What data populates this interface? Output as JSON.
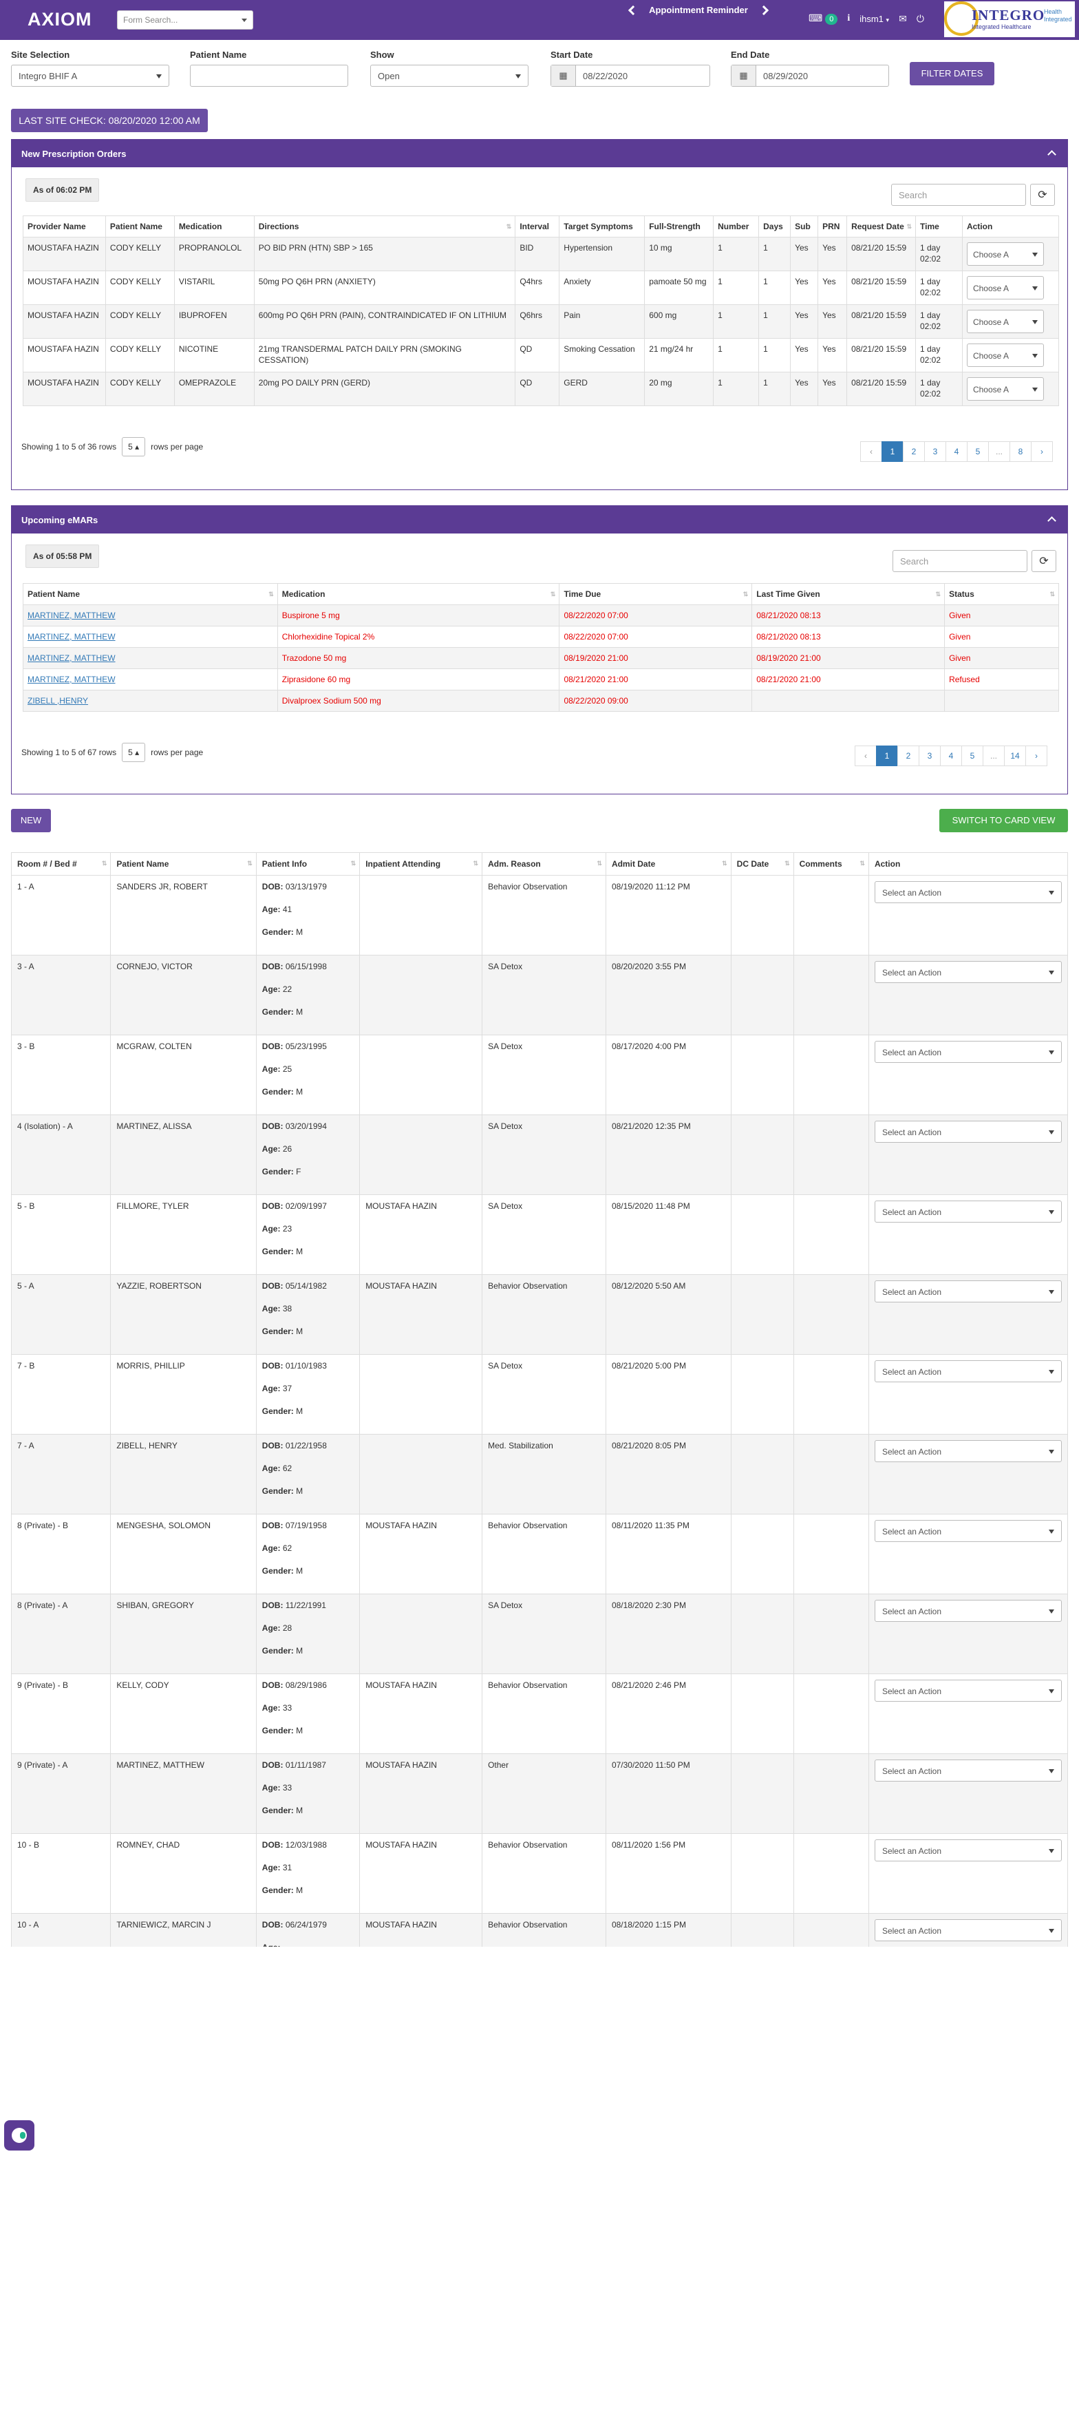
{
  "app": {
    "brand": "AXIOM"
  },
  "topbar": {
    "form_search_placeholder": "Form Search...",
    "appointment_reminder": "Appointment Reminder",
    "message_count": "0",
    "user_menu": "ihsm1",
    "logo_text": "INTEGRO",
    "logo_sub": "Integrated Healthcare",
    "logo_side": "Health Integrated"
  },
  "filters": {
    "site_label": "Site Selection",
    "site_value": "Integro BHIF A",
    "patient_label": "Patient Name",
    "patient_value": "",
    "show_label": "Show",
    "show_value": "Open",
    "start_label": "Start Date",
    "start_value": "08/22/2020",
    "end_label": "End Date",
    "end_value": "08/29/2020",
    "filter_button": "FILTER DATES",
    "last_site_check": "LAST SITE CHECK: 08/20/2020 12:00 AM"
  },
  "prescriptions": {
    "title": "New Prescription Orders",
    "as_of": "As of 06:02 PM",
    "search_placeholder": "Search",
    "columns": [
      "Provider Name",
      "Patient Name",
      "Medication",
      "Directions",
      "Interval",
      "Target Symptoms",
      "Full-Strength",
      "Number",
      "Days",
      "Sub",
      "PRN",
      "Request Date",
      "Time",
      "Action"
    ],
    "rows": [
      {
        "provider": "MOUSTAFA HAZIN",
        "patient": "CODY KELLY",
        "medication": "PROPRANOLOL",
        "directions": "PO BID PRN (HTN) SBP > 165",
        "interval": "BID",
        "symptoms": "Hypertension",
        "strength": "10 mg",
        "number": "1",
        "days": "1",
        "sub": "Yes",
        "prn": "Yes",
        "request_date": "08/21/20 15:59",
        "time": "1 day 02:02",
        "action": "Choose A"
      },
      {
        "provider": "MOUSTAFA HAZIN",
        "patient": "CODY KELLY",
        "medication": "VISTARIL",
        "directions": "50mg PO Q6H PRN (ANXIETY)",
        "interval": "Q4hrs",
        "symptoms": "Anxiety",
        "strength": "pamoate 50 mg",
        "number": "1",
        "days": "1",
        "sub": "Yes",
        "prn": "Yes",
        "request_date": "08/21/20 15:59",
        "time": "1 day 02:02",
        "action": "Choose A"
      },
      {
        "provider": "MOUSTAFA HAZIN",
        "patient": "CODY KELLY",
        "medication": "IBUPROFEN",
        "directions": "600mg PO Q6H PRN (PAIN), CONTRAINDICATED IF ON LITHIUM",
        "interval": "Q6hrs",
        "symptoms": "Pain",
        "strength": "600 mg",
        "number": "1",
        "days": "1",
        "sub": "Yes",
        "prn": "Yes",
        "request_date": "08/21/20 15:59",
        "time": "1 day 02:02",
        "action": "Choose A"
      },
      {
        "provider": "MOUSTAFA HAZIN",
        "patient": "CODY KELLY",
        "medication": "NICOTINE",
        "directions": "21mg TRANSDERMAL PATCH DAILY PRN (SMOKING CESSATION)",
        "interval": "QD",
        "symptoms": "Smoking Cessation",
        "strength": "21 mg/24 hr",
        "number": "1",
        "days": "1",
        "sub": "Yes",
        "prn": "Yes",
        "request_date": "08/21/20 15:59",
        "time": "1 day 02:02",
        "action": "Choose A"
      },
      {
        "provider": "MOUSTAFA HAZIN",
        "patient": "CODY KELLY",
        "medication": "OMEPRAZOLE",
        "directions": "20mg PO DAILY PRN (GERD)",
        "interval": "QD",
        "symptoms": "GERD",
        "strength": "20 mg",
        "number": "1",
        "days": "1",
        "sub": "Yes",
        "prn": "Yes",
        "request_date": "08/21/20 15:59",
        "time": "1 day 02:02",
        "action": "Choose A"
      }
    ],
    "showing": "Showing 1 to 5 of 36 rows",
    "page_size": "5",
    "rows_per_page": "rows per page",
    "pages": [
      "‹",
      "1",
      "2",
      "3",
      "4",
      "5",
      "...",
      "8",
      "›"
    ]
  },
  "emars": {
    "title": "Upcoming eMARs",
    "as_of": "As of 05:58 PM",
    "search_placeholder": "Search",
    "columns": [
      "Patient Name",
      "Medication",
      "Time Due",
      "Last Time Given",
      "Status"
    ],
    "rows": [
      {
        "patient": "MARTINEZ, MATTHEW",
        "medication": "Buspirone 5 mg",
        "due": "08/22/2020 07:00",
        "last": "08/21/2020 08:13",
        "status": "Given"
      },
      {
        "patient": "MARTINEZ, MATTHEW",
        "medication": "Chlorhexidine Topical 2%",
        "due": "08/22/2020 07:00",
        "last": "08/21/2020 08:13",
        "status": "Given"
      },
      {
        "patient": "MARTINEZ, MATTHEW",
        "medication": "Trazodone 50 mg",
        "due": "08/19/2020 21:00",
        "last": "08/19/2020 21:00",
        "status": "Given"
      },
      {
        "patient": "MARTINEZ, MATTHEW",
        "medication": "Ziprasidone 60 mg",
        "due": "08/21/2020 21:00",
        "last": "08/21/2020 21:00",
        "status": "Refused"
      },
      {
        "patient": "ZIBELL ,HENRY",
        "medication": "Divalproex Sodium 500 mg",
        "due": "08/22/2020 09:00",
        "last": "",
        "status": ""
      }
    ],
    "showing": "Showing 1 to 5 of 67 rows",
    "page_size": "5",
    "rows_per_page": "rows per page",
    "pages": [
      "‹",
      "1",
      "2",
      "3",
      "4",
      "5",
      "...",
      "14",
      "›"
    ]
  },
  "census": {
    "new_button": "NEW",
    "card_view_button": "SWITCH TO CARD VIEW",
    "columns": [
      "Room # / Bed #",
      "Patient Name",
      "Patient Info",
      "Inpatient Attending",
      "Adm. Reason",
      "Admit Date",
      "DC Date",
      "Comments",
      "Action"
    ],
    "dob_label": "DOB:",
    "age_label": "Age:",
    "gender_label": "Gender:",
    "action_placeholder": "Select an Action",
    "rows": [
      {
        "room": "1 - A",
        "name": "SANDERS JR, ROBERT",
        "dob": "03/13/1979",
        "age": "41",
        "gender": "M",
        "attending": "",
        "reason": "Behavior Observation",
        "admit": "08/19/2020 11:12 PM"
      },
      {
        "room": "3 - A",
        "name": "CORNEJO, VICTOR",
        "dob": "06/15/1998",
        "age": "22",
        "gender": "M",
        "attending": "",
        "reason": "SA Detox",
        "admit": "08/20/2020 3:55 PM"
      },
      {
        "room": "3 - B",
        "name": "MCGRAW, COLTEN",
        "dob": "05/23/1995",
        "age": "25",
        "gender": "M",
        "attending": "",
        "reason": "SA Detox",
        "admit": "08/17/2020 4:00 PM"
      },
      {
        "room": "4 (Isolation) - A",
        "name": "MARTINEZ, ALISSA",
        "dob": "03/20/1994",
        "age": "26",
        "gender": "F",
        "attending": "",
        "reason": "SA Detox",
        "admit": "08/21/2020 12:35 PM"
      },
      {
        "room": "5 - B",
        "name": "FILLMORE, TYLER",
        "dob": "02/09/1997",
        "age": "23",
        "gender": "M",
        "attending": "MOUSTAFA HAZIN",
        "reason": "SA Detox",
        "admit": "08/15/2020 11:48 PM"
      },
      {
        "room": "5 - A",
        "name": "YAZZIE, ROBERTSON",
        "dob": "05/14/1982",
        "age": "38",
        "gender": "M",
        "attending": "MOUSTAFA HAZIN",
        "reason": "Behavior Observation",
        "admit": "08/12/2020 5:50 AM"
      },
      {
        "room": "7 - B",
        "name": "MORRIS, PHILLIP",
        "dob": "01/10/1983",
        "age": "37",
        "gender": "M",
        "attending": "",
        "reason": "SA Detox",
        "admit": "08/21/2020 5:00 PM"
      },
      {
        "room": "7 - A",
        "name": "ZIBELL, HENRY",
        "dob": "01/22/1958",
        "age": "62",
        "gender": "M",
        "attending": "",
        "reason": "Med. Stabilization",
        "admit": "08/21/2020 8:05 PM"
      },
      {
        "room": "8 (Private) - B",
        "name": "MENGESHA, SOLOMON",
        "dob": "07/19/1958",
        "age": "62",
        "gender": "M",
        "attending": "MOUSTAFA HAZIN",
        "reason": "Behavior Observation",
        "admit": "08/11/2020 11:35 PM"
      },
      {
        "room": "8 (Private) - A",
        "name": "SHIBAN, GREGORY",
        "dob": "11/22/1991",
        "age": "28",
        "gender": "M",
        "attending": "",
        "reason": "SA Detox",
        "admit": "08/18/2020 2:30 PM"
      },
      {
        "room": "9 (Private) - B",
        "name": "KELLY, CODY",
        "dob": "08/29/1986",
        "age": "33",
        "gender": "M",
        "attending": "MOUSTAFA HAZIN",
        "reason": "Behavior Observation",
        "admit": "08/21/2020 2:46 PM"
      },
      {
        "room": "9 (Private) - A",
        "name": "MARTINEZ, MATTHEW",
        "dob": "01/11/1987",
        "age": "33",
        "gender": "M",
        "attending": "MOUSTAFA HAZIN",
        "reason": "Other",
        "admit": "07/30/2020 11:50 PM"
      },
      {
        "room": "10 - B",
        "name": "ROMNEY, CHAD",
        "dob": "12/03/1988",
        "age": "31",
        "gender": "M",
        "attending": "MOUSTAFA HAZIN",
        "reason": "Behavior Observation",
        "admit": "08/11/2020 1:56 PM"
      },
      {
        "room": "10 - A",
        "name": "TARNIEWICZ, MARCIN J",
        "dob": "06/24/1979",
        "age": "",
        "gender": "",
        "attending": "MOUSTAFA HAZIN",
        "reason": "Behavior Observation",
        "admit": "08/18/2020 1:15 PM"
      }
    ]
  },
  "colors": {
    "primary": "#5b3b94",
    "button": "#6a4ea3",
    "success": "#4cae4c",
    "danger": "#e60000",
    "link": "#337ab7"
  }
}
